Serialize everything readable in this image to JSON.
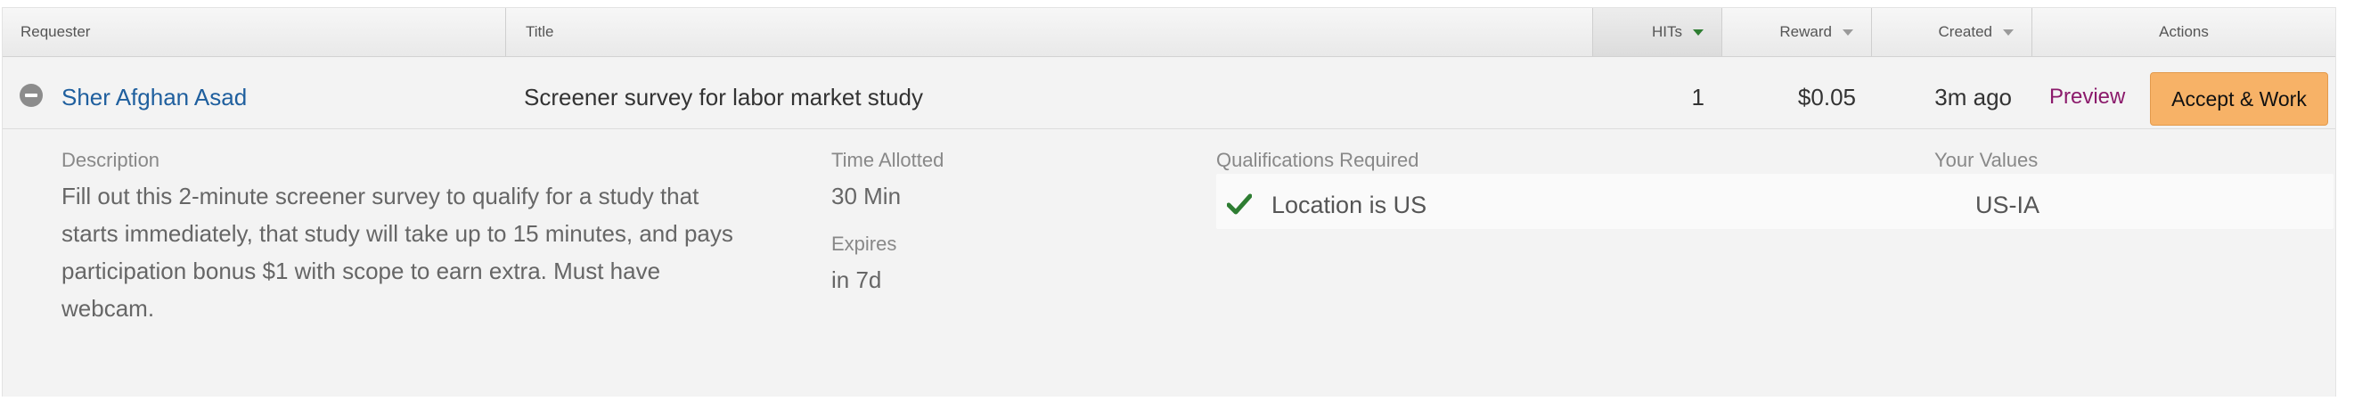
{
  "header": {
    "requester": "Requester",
    "title": "Title",
    "hits": "HITs",
    "reward": "Reward",
    "created": "Created",
    "actions": "Actions"
  },
  "hit": {
    "requester": "Sher Afghan Asad",
    "title": "Screener survey for labor market study",
    "hits": "1",
    "reward": "$0.05",
    "created": "3m ago",
    "preview_label": "Preview",
    "accept_label": "Accept & Work"
  },
  "details": {
    "description_label": "Description",
    "description_lines": [
      "Fill out this 2-minute screener survey to qualify for a study that",
      "starts immediately, that study will take up to 15 minutes, and pays",
      "participation bonus $1 with scope to earn extra. Must have",
      "webcam."
    ],
    "time_allotted_label": "Time Allotted",
    "time_allotted": "30 Min",
    "expires_label": "Expires",
    "expires": "in 7d",
    "qualifications_label": "Qualifications Required",
    "your_values_label": "Your Values",
    "qualifications": [
      {
        "name": "Location is US",
        "value": "US-IA",
        "met": true
      }
    ]
  },
  "colors": {
    "link": "#1f5f9e",
    "preview": "#8b1a6b",
    "accept_bg": "#f7b267",
    "check": "#2e7d32"
  }
}
